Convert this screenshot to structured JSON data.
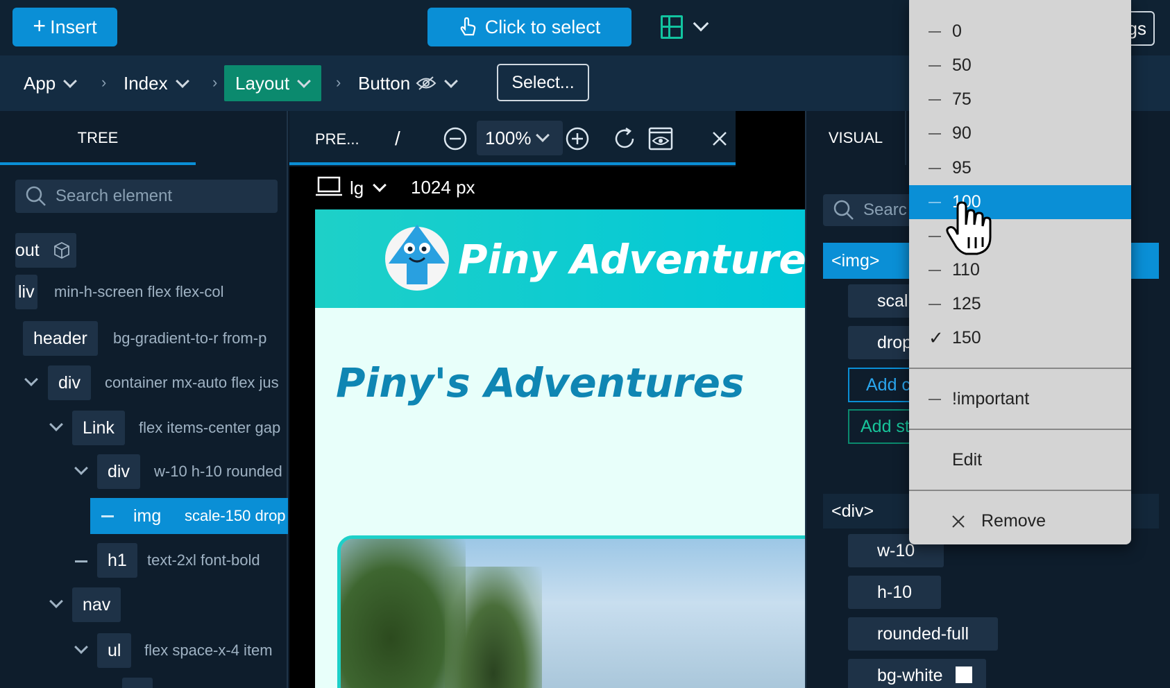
{
  "toolbar": {
    "insert_label": "Insert",
    "click_select_label": "Click to select",
    "settings_label_partial": "gs"
  },
  "breadcrumb": {
    "items": [
      "App",
      "Index",
      "Layout",
      "Button"
    ],
    "select_label": "Select..."
  },
  "tree": {
    "tab_label": "TREE",
    "search_placeholder": "Search element",
    "nodes": [
      {
        "tag": "out",
        "classes": ""
      },
      {
        "tag": "liv",
        "classes": "min-h-screen flex flex-col"
      },
      {
        "tag": "header",
        "classes": "bg-gradient-to-r from-p"
      },
      {
        "tag": "div",
        "classes": "container mx-auto flex jus"
      },
      {
        "tag": "Link",
        "classes": "flex items-center gap"
      },
      {
        "tag": "div",
        "classes": "w-10 h-10 rounded"
      },
      {
        "tag": "img",
        "classes": "scale-150 drop"
      },
      {
        "tag": "h1",
        "classes": "text-2xl font-bold"
      },
      {
        "tag": "nav",
        "classes": ""
      },
      {
        "tag": "ul",
        "classes": "flex space-x-4 item"
      }
    ]
  },
  "preview": {
    "tab_label": "PRE...",
    "path": "/",
    "zoom": "100%",
    "breakpoint": "lg",
    "width_label": "1024 px",
    "site_title": "Piny Adventures",
    "page_heading": "Piny's Adventures"
  },
  "visual": {
    "tab_label": "VISUAL",
    "search_placeholder_partial": "Searc",
    "selected_tag": "<img>",
    "img_classes": [
      "scal",
      "drop"
    ],
    "add_class_partial": "Add c",
    "add_style_partial": "Add st",
    "parent_tag": "<div>",
    "div_classes": [
      "w-10",
      "h-10",
      "rounded-full",
      "bg-white"
    ]
  },
  "zoom_menu": {
    "options": [
      "0",
      "50",
      "75",
      "90",
      "95",
      "100",
      "",
      "110",
      "125",
      "150"
    ],
    "highlighted": "100",
    "checked": "150",
    "important_label": "!important",
    "edit_label": "Edit",
    "remove_label": "Remove"
  },
  "colors": {
    "accent": "#0a8fd6",
    "layout_crumb": "#0b8a6e",
    "header_gradient_start": "#1ed0c8",
    "header_gradient_end": "#00c8d8",
    "heading_color": "#0f86b3",
    "preview_bg": "#e8fffa"
  }
}
